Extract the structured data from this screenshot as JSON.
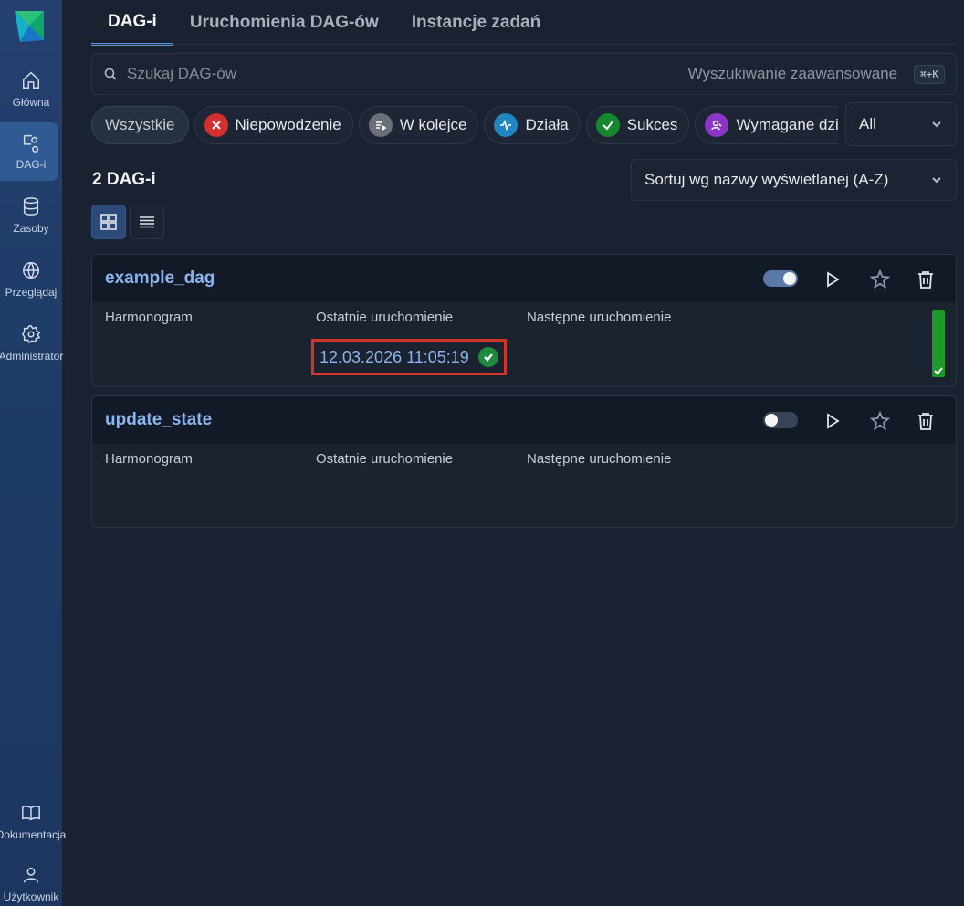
{
  "nav": {
    "items": [
      {
        "label": "Główna",
        "icon": "home-icon"
      },
      {
        "label": "DAG-i",
        "icon": "dag-icon"
      },
      {
        "label": "Zasoby",
        "icon": "database-icon"
      },
      {
        "label": "Przeglądaj",
        "icon": "globe-icon"
      },
      {
        "label": "Administrator",
        "icon": "gear-icon"
      }
    ],
    "bottom": [
      {
        "label": "Dokumentacja",
        "icon": "book-icon"
      },
      {
        "label": "Użytkownik",
        "icon": "user-icon"
      }
    ],
    "active": "DAG-i"
  },
  "tabs": [
    {
      "label": "DAG-i",
      "active": true
    },
    {
      "label": "Uruchomienia DAG-ów",
      "active": false
    },
    {
      "label": "Instancje zadań",
      "active": false
    }
  ],
  "search": {
    "placeholder": "Szukaj DAG-ów",
    "advanced_label": "Wyszukiwanie zaawansowane",
    "shortcut": "⌘+K"
  },
  "filters": [
    {
      "label": "Wszystkie",
      "color": "",
      "icon": ""
    },
    {
      "label": "Niepowodzenie",
      "color": "#d62f2f",
      "icon": "x-icon"
    },
    {
      "label": "W kolejce",
      "color": "#6b6f78",
      "icon": "queue-icon"
    },
    {
      "label": "Działa",
      "color": "#1f86c0",
      "icon": "pulse-icon"
    },
    {
      "label": "Sukces",
      "color": "#17872f",
      "icon": "check-icon"
    },
    {
      "label": "Wymagane dział",
      "color": "#8c36c9",
      "icon": "user-action-icon"
    }
  ],
  "filter_select": {
    "value": "All"
  },
  "count_label": "2 DAG-i",
  "sort": {
    "value": "Sortuj wg nazwy wyświetlanej (A-Z)"
  },
  "columns": {
    "schedule": "Harmonogram",
    "last_run": "Ostatnie uruchomienie",
    "next_run": "Następne uruchomienie"
  },
  "dags": [
    {
      "name": "example_dag",
      "enabled": true,
      "last_run": "12.03.2026 11:05:19",
      "last_state": "success"
    },
    {
      "name": "update_state",
      "enabled": false,
      "last_run": "",
      "last_state": ""
    }
  ],
  "colors": {
    "accent": "#5b93d8",
    "link": "#8bb5ee",
    "success": "#1f8a3b",
    "highlight_box": "#d2342a"
  }
}
